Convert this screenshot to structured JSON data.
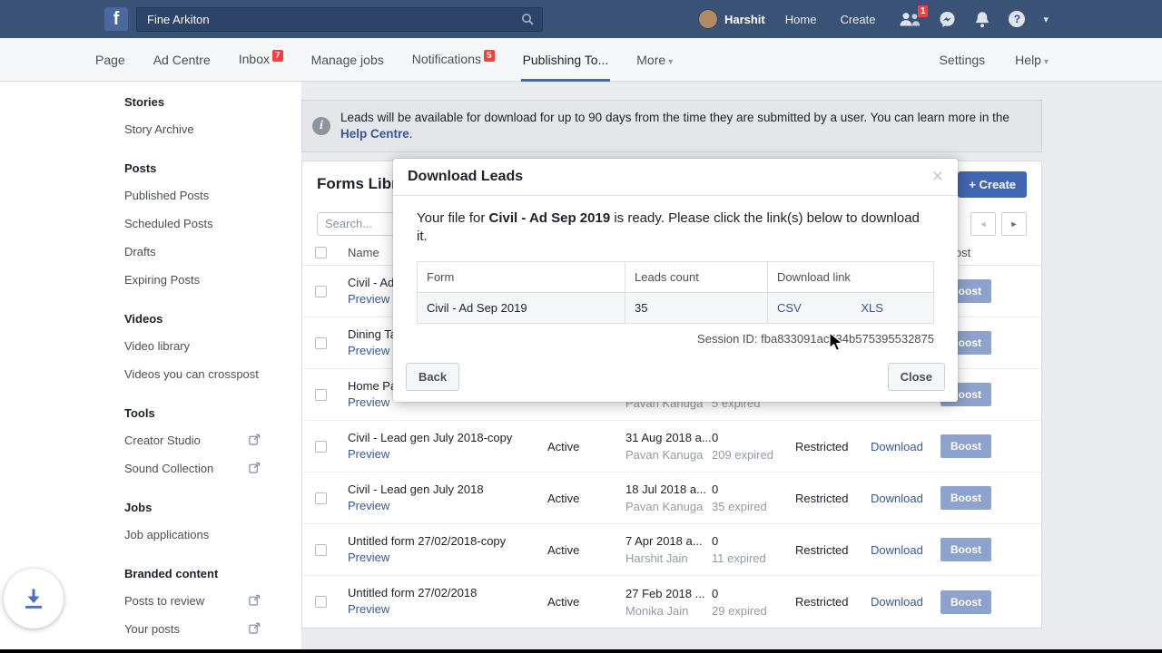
{
  "topbar": {
    "logo": "f",
    "search_value": "Fine Arkiton",
    "user_name": "Harshit",
    "home_label": "Home",
    "create_label": "Create",
    "friends_badge": "1",
    "caret": "▾"
  },
  "subnav": {
    "items": [
      {
        "label": "Page"
      },
      {
        "label": "Ad Centre"
      },
      {
        "label": "Inbox",
        "badge": "7"
      },
      {
        "label": "Manage jobs"
      },
      {
        "label": "Notifications",
        "badge": "5"
      },
      {
        "label": "Publishing To..."
      },
      {
        "label": "More",
        "caret": "▾"
      }
    ],
    "settings_label": "Settings",
    "help_label": "Help",
    "help_caret": "▾"
  },
  "sidebar": {
    "items": [
      {
        "label": "Stories"
      },
      {
        "label": "Story Archive"
      },
      {
        "label": "Posts"
      },
      {
        "label": "Published Posts"
      },
      {
        "label": "Scheduled Posts"
      },
      {
        "label": "Drafts"
      },
      {
        "label": "Expiring Posts"
      },
      {
        "label": "Videos"
      },
      {
        "label": "Video library"
      },
      {
        "label": "Videos you can crosspost"
      },
      {
        "label": "Tools"
      },
      {
        "label": "Creator Studio"
      },
      {
        "label": "Sound Collection"
      },
      {
        "label": "Jobs"
      },
      {
        "label": "Job applications"
      },
      {
        "label": "Branded content"
      },
      {
        "label": "Posts to review"
      },
      {
        "label": "Your posts"
      }
    ]
  },
  "banner": {
    "text": "Leads will be available for download for up to 90 days from the time they are submitted by a user. You can learn more in the",
    "link_label": "Help Centre",
    "suffix": "."
  },
  "panel": {
    "title": "Forms Library",
    "create_button": "+ Create",
    "search_placeholder": "Search...",
    "pagination": {
      "prev": "◄",
      "next": "►"
    },
    "table": {
      "headers": {
        "name": "Name",
        "status": "",
        "created": "",
        "leads": "",
        "sharing": "",
        "download": "",
        "boost": "Boost"
      },
      "rows": [
        {
          "name": "Civil - Ad...",
          "preview": "Preview",
          "status": "",
          "date": "",
          "person": "",
          "leads": "",
          "expired": "",
          "sharing": "",
          "download": "",
          "boost": "Boost"
        },
        {
          "name": "Dining Ta...",
          "preview": "Preview",
          "status": "",
          "date": "",
          "person": "",
          "leads": "",
          "expired": "",
          "sharing": "",
          "download": "",
          "boost": "Boost"
        },
        {
          "name": "Home Pa...",
          "preview": "Preview",
          "status": "",
          "date": "",
          "person": "Pavan Kanuga",
          "leads": "",
          "expired": "5 expired",
          "sharing": "",
          "download": "",
          "boost": "Boost"
        },
        {
          "name": "Civil - Lead gen July 2018-copy",
          "preview": "Preview",
          "status": "Active",
          "date": "31 Aug 2018 a...",
          "person": "Pavan Kanuga",
          "leads": "0",
          "expired": "209 expired",
          "sharing": "Restricted",
          "download": "Download",
          "boost": "Boost"
        },
        {
          "name": "Civil - Lead gen July 2018",
          "preview": "Preview",
          "status": "Active",
          "date": "18 Jul 2018 a...",
          "person": "Pavan Kanuga",
          "leads": "0",
          "expired": "35 expired",
          "sharing": "Restricted",
          "download": "Download",
          "boost": "Boost"
        },
        {
          "name": "Untitled form 27/02/2018-copy",
          "preview": "Preview",
          "status": "Active",
          "date": "7 Apr 2018 a...",
          "person": "Harshit Jain",
          "leads": "0",
          "expired": "11 expired",
          "sharing": "Restricted",
          "download": "Download",
          "boost": "Boost"
        },
        {
          "name": "Untitled form 27/02/2018",
          "preview": "Preview",
          "status": "Active",
          "date": "27 Feb 2018 ...",
          "person": "Monika Jain",
          "leads": "0",
          "expired": "29 expired",
          "sharing": "Restricted",
          "download": "Download",
          "boost": "Boost"
        }
      ]
    }
  },
  "modal": {
    "title": "Download Leads",
    "close_icon": "×",
    "body_before": "Your file for ",
    "form_name": "Civil - Ad Sep 2019",
    "body_after": " is ready. Please click the link(s) below to download it.",
    "table": {
      "col_form": "Form",
      "col_count": "Leads count",
      "col_link": "Download link",
      "row_form": "Civil - Ad Sep 2019",
      "row_count": "35",
      "link_csv": "CSV",
      "link_xls": "XLS"
    },
    "session_id": "Session ID: fba833091ac534b575395532875",
    "back_button": "Back",
    "close_button": "Close"
  },
  "colors": {
    "topbar": "#3a5276",
    "accent": "#4267b2",
    "badge": "#fa3e3e",
    "link": "#365899"
  }
}
